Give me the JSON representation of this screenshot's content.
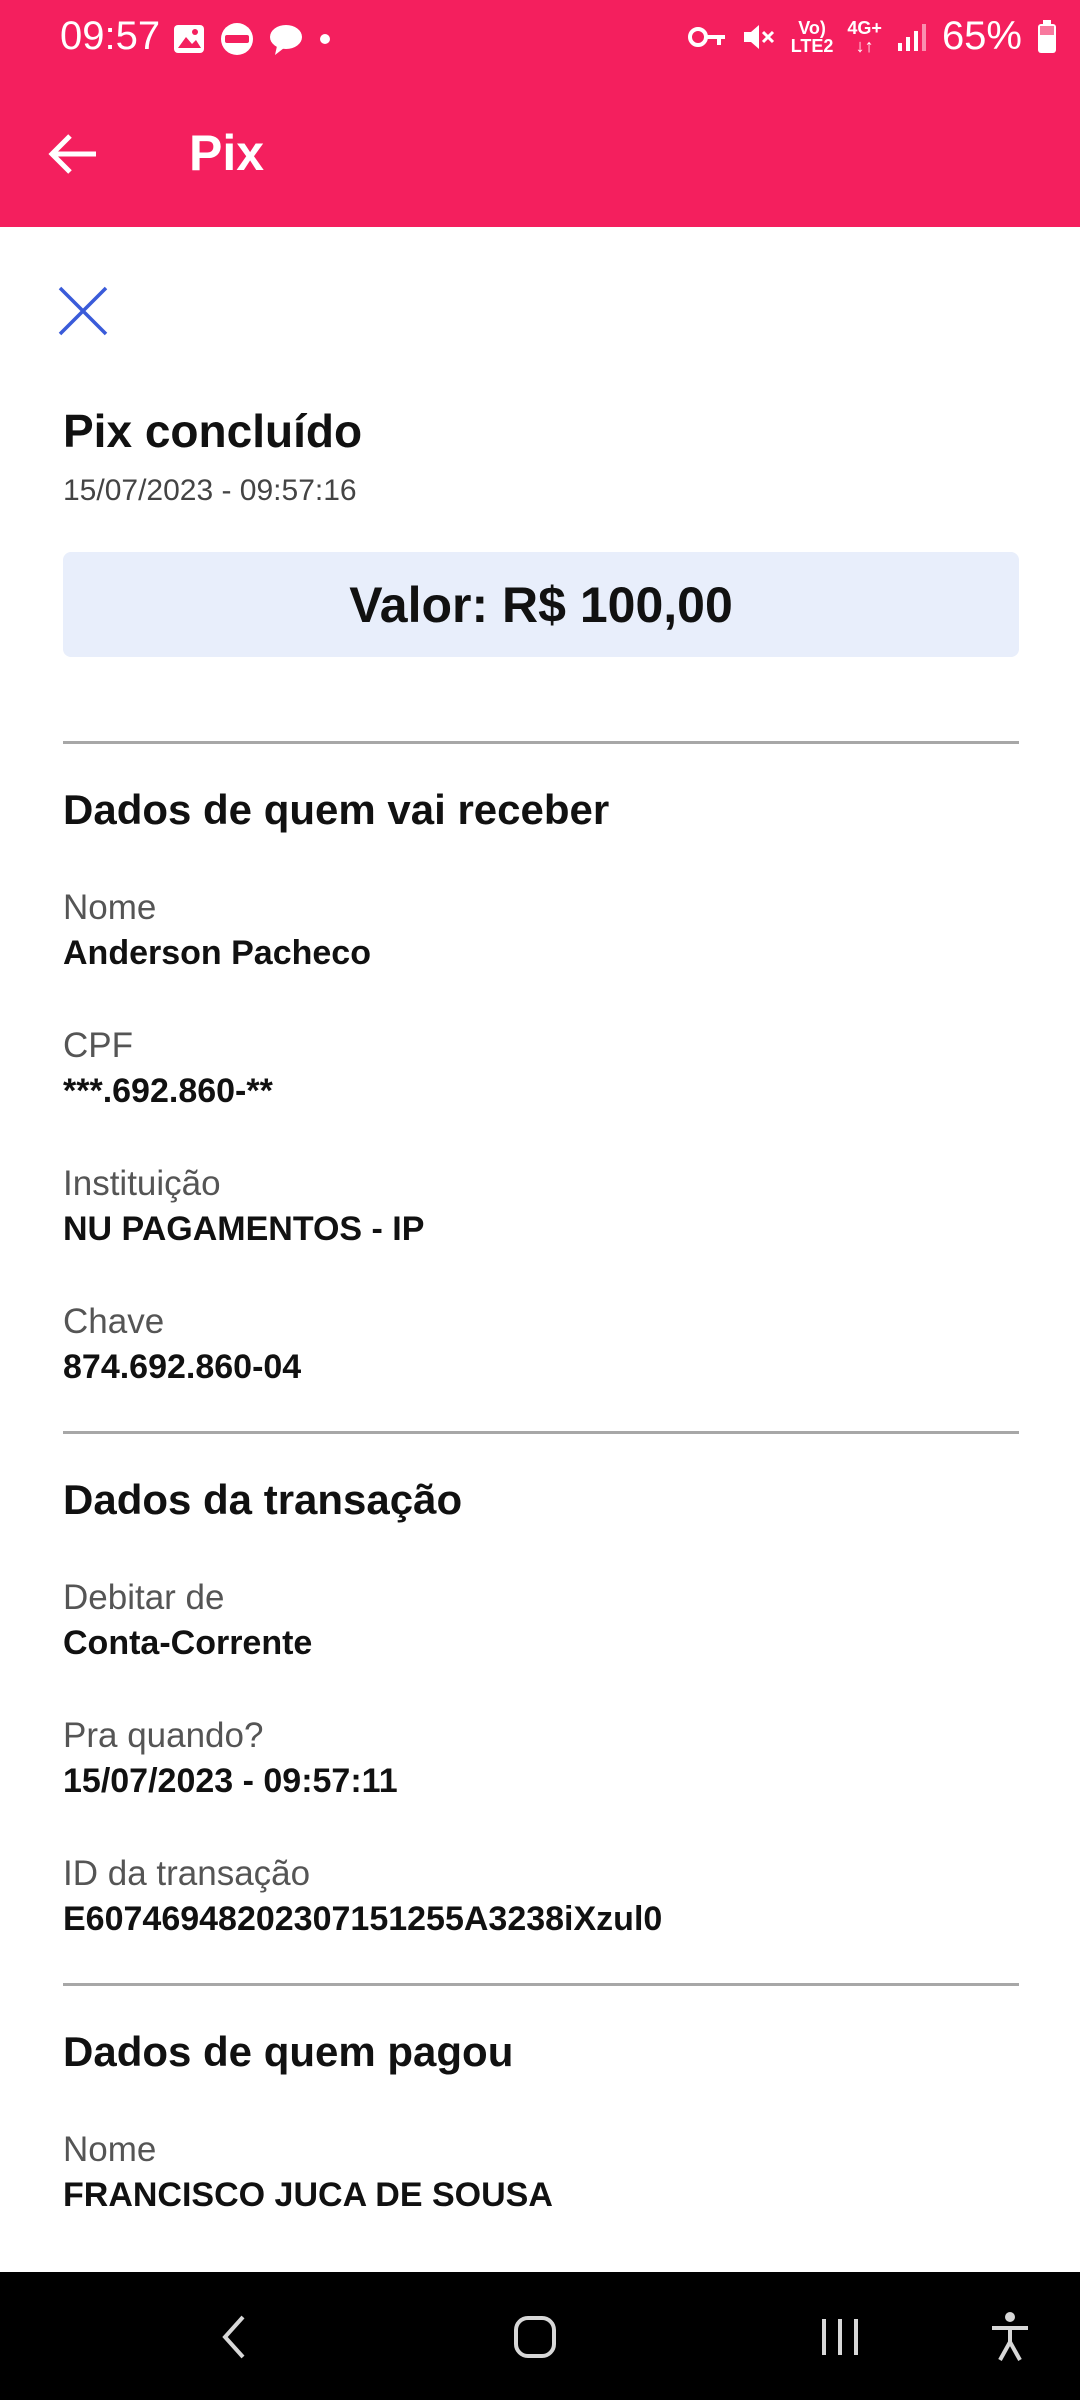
{
  "status_bar": {
    "time": "09:57",
    "battery": "65%",
    "network_top": "Vo)",
    "network_bottom": "LTE2",
    "data_top": "4G+",
    "data_bottom": "↓↑"
  },
  "app_bar": {
    "title": "Pix"
  },
  "receipt": {
    "title": "Pix concluído",
    "datetime": "15/07/2023 - 09:57:16",
    "amount": "Valor: R$ 100,00"
  },
  "receiver": {
    "heading": "Dados de quem vai receber",
    "name_label": "Nome",
    "name_value": "Anderson Pacheco",
    "cpf_label": "CPF",
    "cpf_value": "***.692.860-**",
    "institution_label": "Instituição",
    "institution_value": "NU PAGAMENTOS - IP",
    "key_label": "Chave",
    "key_value": "874.692.860-04"
  },
  "transaction": {
    "heading": "Dados da transação",
    "debit_label": "Debitar de",
    "debit_value": "Conta-Corrente",
    "when_label": "Pra quando?",
    "when_value": "15/07/2023 - 09:57:11",
    "id_label": "ID da transação",
    "id_value": "E60746948202307151255A3238iXzul0"
  },
  "payer": {
    "heading": "Dados de quem pagou",
    "name_label": "Nome",
    "name_value": "FRANCISCO JUCA DE SOUSA"
  },
  "colors": {
    "brand": "#f41f5e",
    "amount_box": "#e8eefb",
    "close_icon": "#3a5bd9"
  },
  "icons": [
    "back-arrow-icon",
    "close-icon",
    "nav-back-icon",
    "nav-home-icon",
    "nav-recents-icon",
    "accessibility-icon"
  ]
}
